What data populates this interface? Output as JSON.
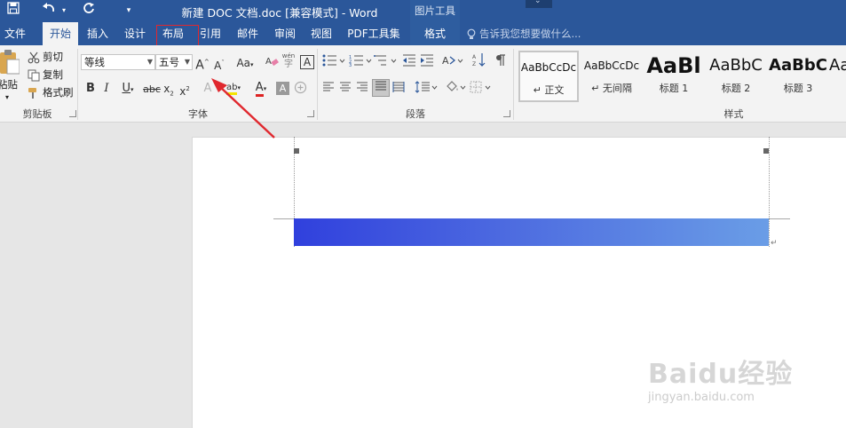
{
  "title_bar": {
    "document_title": "新建 DOC 文档.doc [兼容模式] - Word",
    "context_label": "图片工具",
    "icons": [
      "save-icon",
      "undo-icon",
      "redo-icon",
      "customize-qat-icon"
    ]
  },
  "tabs": [
    {
      "label": "文件"
    },
    {
      "label": "开始"
    },
    {
      "label": "插入"
    },
    {
      "label": "设计"
    },
    {
      "label": "布局"
    },
    {
      "label": "引用"
    },
    {
      "label": "邮件"
    },
    {
      "label": "审阅"
    },
    {
      "label": "视图"
    },
    {
      "label": "PDF工具集"
    },
    {
      "label": "格式"
    }
  ],
  "active_tab": "开始",
  "highlighted_tab": "布局",
  "tell_me": "告诉我您想要做什么...",
  "clipboard": {
    "paste": "粘贴",
    "cut": "剪切",
    "copy": "复制",
    "format_painter": "格式刷",
    "group_label": "剪贴板"
  },
  "font": {
    "font_name": "等线",
    "font_size": "五号",
    "group_label": "字体",
    "grow": "A",
    "shrink": "A",
    "change_case": "Aa",
    "bold": "B",
    "italic": "I",
    "underline": "U",
    "strikethrough": "abc",
    "subscript": "x",
    "superscript": "x",
    "text_effect": "A",
    "highlight": "ab",
    "font_color": "A",
    "char_shading": "A",
    "enclose": "字",
    "phonetic": "wén",
    "char_border": "A"
  },
  "paragraph": {
    "group_label": "段落"
  },
  "styles": {
    "group_label": "样式",
    "items": [
      {
        "sample": "AaBbCcDc",
        "name": "正文"
      },
      {
        "sample": "AaBbCcDc",
        "name": "无间隔"
      },
      {
        "sample": "AaBl",
        "name": "标题 1"
      },
      {
        "sample": "AaBbC",
        "name": "标题 2"
      },
      {
        "sample": "AaBbC",
        "name": "标题 3"
      },
      {
        "sample": "Aa",
        "name": ""
      }
    ]
  },
  "watermark": {
    "brand": "Baidu经验",
    "url": "jingyan.baidu.com"
  },
  "colors": {
    "title_bar": "#2b579a",
    "ribbon_bg": "#f3f3f3",
    "annotation_red": "#e0282e",
    "gradient_start": "#3040dd",
    "gradient_end": "#6a9de6"
  }
}
